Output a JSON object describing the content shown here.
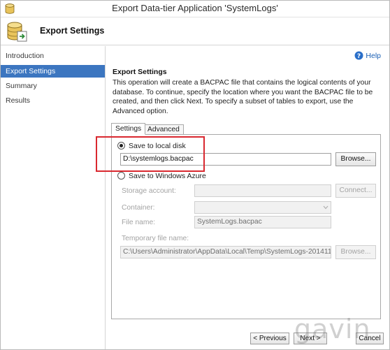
{
  "window": {
    "title": "Export Data-tier Application 'SystemLogs'"
  },
  "header": {
    "title": "Export Settings"
  },
  "sidebar": {
    "items": [
      {
        "label": "Introduction"
      },
      {
        "label": "Export Settings"
      },
      {
        "label": "Summary"
      },
      {
        "label": "Results"
      }
    ],
    "active_index": 1
  },
  "main": {
    "help_label": "Help",
    "section_title": "Export Settings",
    "description": "This operation will create a BACPAC file that contains the logical contents of your database. To continue, specify the location where you want the BACPAC file to be created, and then click Next. To specify a subset of tables to export, use the Advanced option.",
    "tabs": [
      {
        "label": "Settings"
      },
      {
        "label": "Advanced"
      }
    ],
    "active_tab": 0,
    "local_disk": {
      "radio_label": "Save to local disk",
      "checked": true,
      "path_value": "D:\\systemlogs.bacpac",
      "browse_label": "Browse..."
    },
    "azure": {
      "radio_label": "Save to Windows Azure",
      "checked": false,
      "storage_account_label": "Storage account:",
      "storage_account_value": "",
      "connect_label": "Connect...",
      "container_label": "Container:",
      "container_value": "",
      "file_name_label": "File name:",
      "file_name_value": "SystemLogs.bacpac",
      "temp_file_label": "Temporary file name:",
      "temp_file_value": "C:\\Users\\Administrator\\AppData\\Local\\Temp\\SystemLogs-201411",
      "browse_label": "Browse..."
    }
  },
  "footer": {
    "previous_label": "< Previous",
    "next_label": "Next >",
    "cancel_label": "Cancel"
  },
  "watermark": "gavin",
  "colors": {
    "accent": "#3c76c0",
    "highlight": "#d9282f",
    "link": "#1a5fb4"
  }
}
